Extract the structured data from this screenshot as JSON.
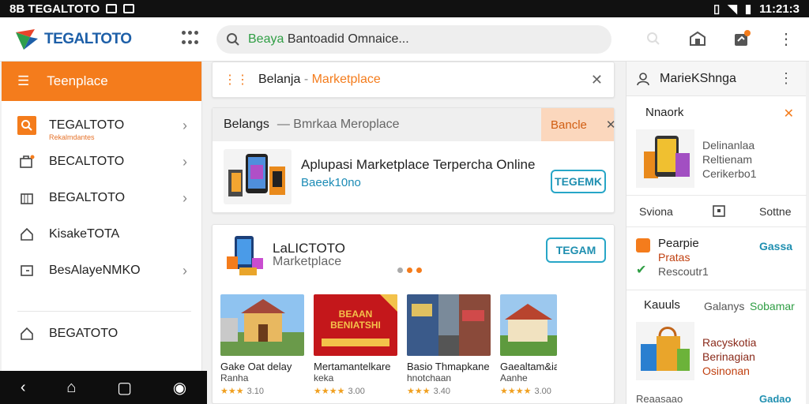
{
  "status_bar": {
    "left_text": "8B TEGALTOTO",
    "time": "11:21:3"
  },
  "header": {
    "logo_text": "TEGALTOTO",
    "search": {
      "query_green": "Beaya",
      "query_rest": " Bantoadid Omnaice..."
    }
  },
  "sidebar": {
    "head_label": "Teenplace",
    "items": [
      {
        "label": "TEGALTOTO",
        "sub": "Rekalmdantes",
        "icon": "search-icon"
      },
      {
        "label": "BECALTOTO",
        "icon": "cart-icon"
      },
      {
        "label": "BEGALTOTO",
        "icon": "building-icon"
      },
      {
        "label": "KisakeTOTA",
        "icon": "home-icon"
      },
      {
        "label": "BesAlayeNMKO",
        "icon": "folder-icon"
      },
      {
        "label": "BEGATOTO",
        "icon": "home-icon"
      }
    ]
  },
  "breadcrumb": {
    "part1": "Belanja",
    "sep": " - ",
    "part2": "Marketplace"
  },
  "promo": {
    "head_title": "Belangs",
    "head_sub": "— Bmrkaa Meroplace",
    "tag_label": "Bancle",
    "title": "Aplupasi Marketplace Terpercha Online",
    "subtitle": "Baeek10no",
    "button_label": "TEGEMK"
  },
  "store": {
    "name": "LaLICTOTO",
    "sub": "Marketplace",
    "button_label": "TEGAM",
    "tiles": [
      {
        "title": "Gake Oat delay",
        "subtitle": "Ranha",
        "stars": "★★★",
        "count": "3.10"
      },
      {
        "title": "Mertamantelkare",
        "subtitle": "keka",
        "stars": "★★★★",
        "count": "3.00"
      },
      {
        "title": "Basio Thmapkane",
        "subtitle": "hnotchaan",
        "stars": "★★★",
        "count": "3.40"
      },
      {
        "title": "Gaealtam&ia",
        "subtitle": "Aanhe",
        "stars": "★★★★",
        "count": "3.00"
      }
    ],
    "tile_banner_text": "BEAAN BENIATSHI"
  },
  "right_panel": {
    "title": "MarieKShnga",
    "section1": {
      "title": "Nnaork",
      "line1": "Delinanlaa",
      "line2": "Reltienam",
      "line3": "Cerikerbo1"
    },
    "tabs": {
      "left": "Sviona",
      "right": "Sottne"
    },
    "section2": {
      "line1": "Pearpie",
      "line2": "Pratas",
      "line3": "Rescoutr1",
      "link": "Gassa"
    },
    "section3": {
      "title": "Kauuls",
      "meta_grey": "Galanys",
      "meta_green": "Sobamar",
      "line1": "Racyskotia",
      "line2": "Berinagian",
      "line3": "Osinonan"
    },
    "footer_left": "Reaasaao",
    "footer_right": "Gadao"
  },
  "colors": {
    "accent": "#f47c1c",
    "link": "#1f8fb0",
    "logo": "#1d5fa8"
  }
}
